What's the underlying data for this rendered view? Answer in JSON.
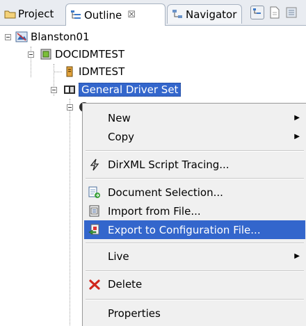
{
  "tabs": [
    {
      "label": "Project"
    },
    {
      "label": "Outline",
      "close": "☒"
    },
    {
      "label": "Navigator"
    }
  ],
  "tree": {
    "root": "Blanston01",
    "child1": "DOCIDMTEST",
    "child2": "IDMTEST",
    "child3": "General Driver Set"
  },
  "menu": {
    "new": "New",
    "copy": "Copy",
    "script_tracing": "DirXML Script Tracing...",
    "document_selection": "Document Selection...",
    "import": "Import from File...",
    "export": "Export to Configuration File...",
    "live": "Live",
    "delete": "Delete",
    "properties": "Properties"
  },
  "colors": {
    "selection": "#3366cc",
    "menu_bg": "#f0f0f0"
  }
}
